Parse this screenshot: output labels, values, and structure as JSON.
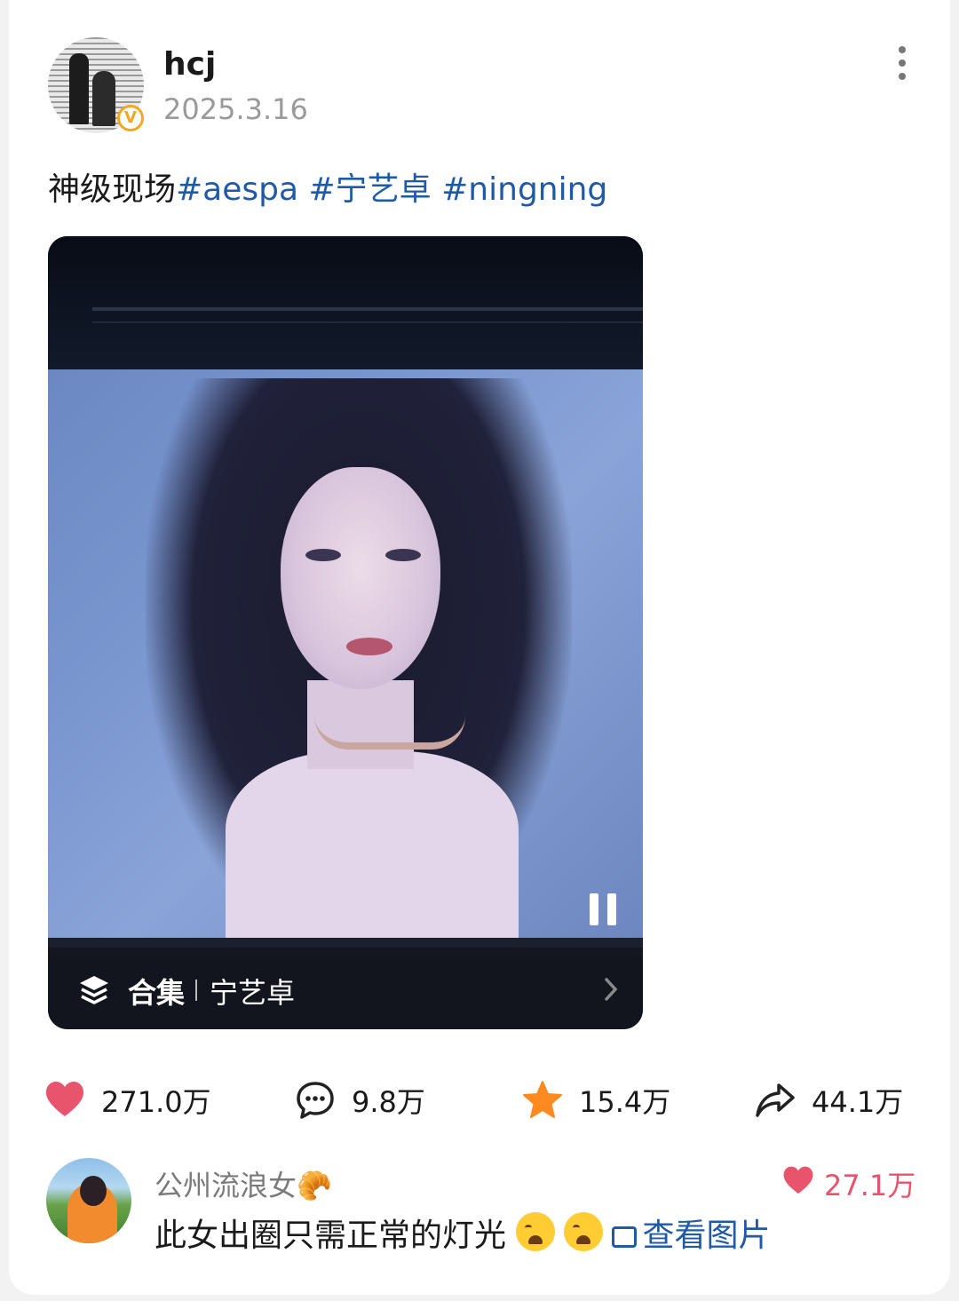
{
  "post": {
    "author": "hcj",
    "date": "2025.3.16",
    "verified_badge": "V",
    "text": "神级现场",
    "hashtags": [
      "#aespa",
      "#宁艺卓",
      "#ningning"
    ]
  },
  "video": {
    "collection_label": "合集",
    "collection_name": "宁艺卓",
    "icons": [
      "layers-icon",
      "pause-icon",
      "chevron-right-icon"
    ]
  },
  "stats": {
    "likes": "271.0万",
    "comments": "9.8万",
    "favorites": "15.4万",
    "shares": "44.1万"
  },
  "comment": {
    "author": "公州流浪女",
    "author_emoji": "🥐",
    "likes": "27.1万",
    "text": "此女出圈只需正常的灯光",
    "view_image_label": "查看图片"
  },
  "colors": {
    "hashtag": "#1f5aa8",
    "like_red": "#e8546c",
    "star_orange": "#ff8a1f",
    "verified_gold": "#f5a623"
  }
}
